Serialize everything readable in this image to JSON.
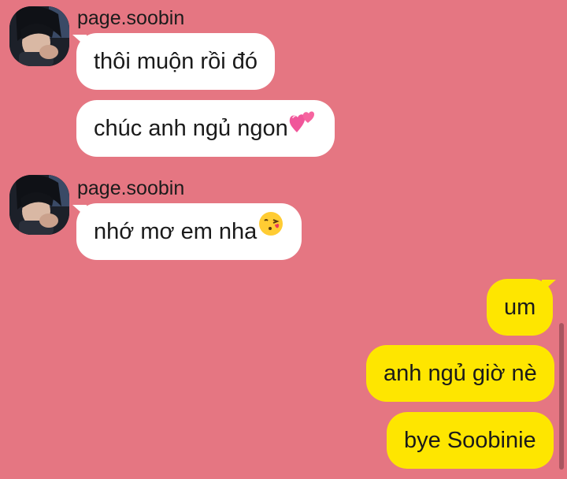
{
  "colors": {
    "background": "#e57682",
    "incoming_bubble": "#ffffff",
    "outgoing_bubble": "#fee600"
  },
  "groups": [
    {
      "sender": "page.soobin",
      "messages": [
        {
          "text": "thôi muộn rồi đó"
        },
        {
          "text": "chúc anh ngủ ngon",
          "emoji": "two-hearts-emoji"
        }
      ]
    },
    {
      "sender": "page.soobin",
      "messages": [
        {
          "text": "nhớ mơ em nha",
          "emoji": "face-blowing-kiss-emoji"
        }
      ]
    }
  ],
  "outgoing": [
    {
      "text": "um"
    },
    {
      "text": "anh ngủ giờ nè"
    },
    {
      "text": "bye Soobinie"
    }
  ]
}
